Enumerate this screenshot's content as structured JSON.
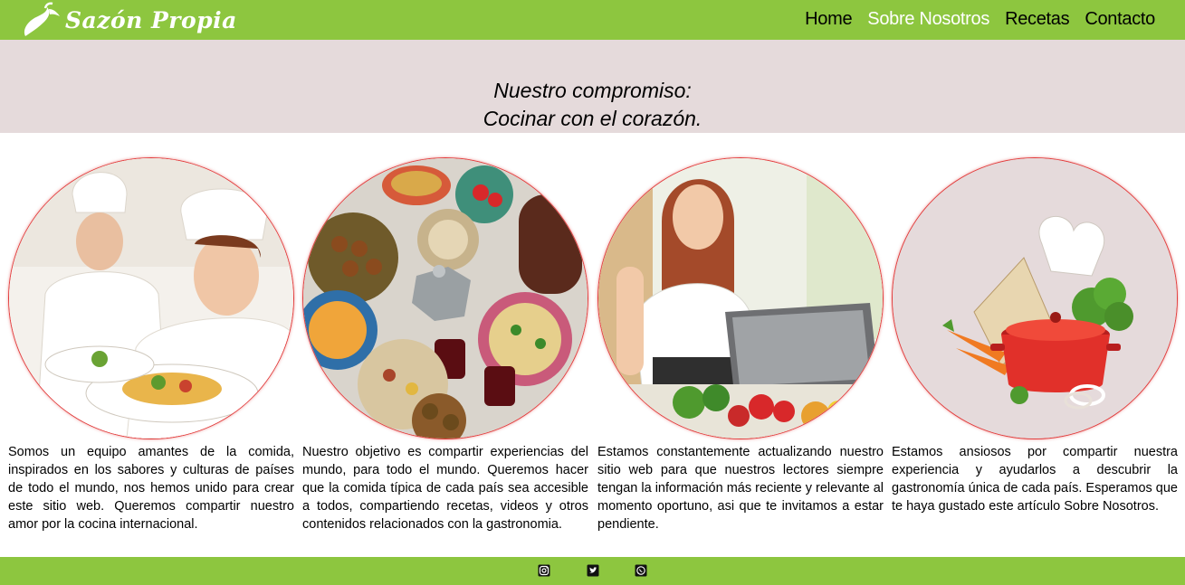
{
  "brand": {
    "name": "Sazón Propia"
  },
  "nav": {
    "items": [
      {
        "label": "Home"
      },
      {
        "label": "Sobre Nosotros",
        "active": true
      },
      {
        "label": "Recetas"
      },
      {
        "label": "Contacto"
      }
    ]
  },
  "hero": {
    "line1": "Nuestro compromiso:",
    "line2": "Cocinar con el corazón."
  },
  "cards": [
    {
      "image": "chefs-plating-food-photo",
      "text": "Somos un equipo amantes de la comida, inspirados en los sabores y culturas de países de todo el mundo, nos hemos unido para crear este sitio web. Queremos compartir nuestro amor por la cocina internacional."
    },
    {
      "image": "international-dishes-table-photo",
      "text": "Nuestro objetivo es compartir experiencias del mundo, para todo el mundo. Queremos hacer que la comida típica de cada país sea accesible a todos, compartiendo recetas, videos y otros contenidos relacionados con la gastronomia."
    },
    {
      "image": "woman-cooking-with-laptop-photo",
      "text": "Estamos constantemente actualizando nuestro sitio web para que nuestros lectores siempre tengan la información más reciente y relevante al momento oportuno, asi que te invitamos a estar pendiente."
    },
    {
      "image": "chef-hat-pot-vegetables-photo",
      "text": "Estamos ansiosos por compartir nuestra experiencia y ayudarlos a descubrir la gastronomía única de cada país. Esperamos que te haya gustado este artículo Sobre Nosotros."
    }
  ],
  "footer": {
    "icons": [
      "instagram-icon",
      "twitter-icon",
      "whatsapp-icon"
    ]
  },
  "colors": {
    "header_green": "#8dc63f",
    "hero_bg": "#e5dadb",
    "circle_border": "#e23b3b",
    "active_link": "#ffffff"
  }
}
